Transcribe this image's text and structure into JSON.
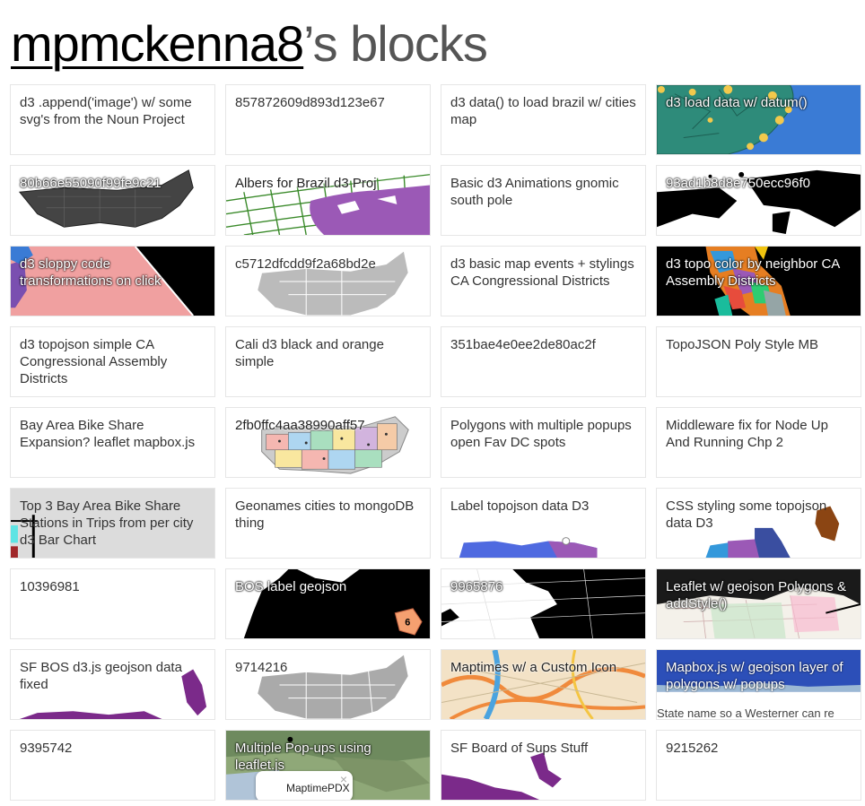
{
  "header": {
    "user": "mpmckenna8",
    "suffix": "’s blocks"
  },
  "cards": [
    {
      "title": "d3 .append('image') w/ some svg's from the Noun Project",
      "thumb": "none"
    },
    {
      "title": "857872609d893d123e67",
      "thumb": "none"
    },
    {
      "title": "d3 data() to load brazil w/ cities map",
      "thumb": "none"
    },
    {
      "title": "d3 load data w/ datum()",
      "thumb": "brazil-cities"
    },
    {
      "title": "80b66e55090f99fe9c21",
      "thumb": "us-dark-counties"
    },
    {
      "title": "Albers for Brazil d3 Proj",
      "thumb": "albers-grid"
    },
    {
      "title": "Basic d3 Animations gnomic south pole",
      "thumb": "none"
    },
    {
      "title": "93ad1b8d8e750ecc96f0",
      "thumb": "black-world"
    },
    {
      "title": "d3 sloppy code transformations on click",
      "thumb": "sloppy-pink"
    },
    {
      "title": "c5712dfcdd9f2a68bd2e",
      "thumb": "us-gray"
    },
    {
      "title": "d3 basic map events + stylings CA Congressional Districts",
      "thumb": "none"
    },
    {
      "title": "d3 topo color by neighbor CA Assembly Districts",
      "thumb": "ca-colored"
    },
    {
      "title": "d3 topojson simple CA Congressional Assembly Districts",
      "thumb": "none"
    },
    {
      "title": "Cali d3 black and orange simple",
      "thumb": "none"
    },
    {
      "title": "351bae4e0ee2de80ac2f",
      "thumb": "none"
    },
    {
      "title": "TopoJSON Poly Style MB",
      "thumb": "none"
    },
    {
      "title": "Bay Area Bike Share Expansion? leaflet mapbox.js",
      "thumb": "none"
    },
    {
      "title": "2fb0ffc4aa38990aff57",
      "thumb": "us-colored-counties"
    },
    {
      "title": "Polygons with multiple popups open Fav DC spots",
      "thumb": "none"
    },
    {
      "title": "Middleware fix for Node Up And Running Chp 2",
      "thumb": "none"
    },
    {
      "title": "Top 3 Bay Area Bike Share Stations in Trips from per city d3 Bar Chart",
      "thumb": "bar-gray"
    },
    {
      "title": "Geonames cities to mongoDB thing",
      "thumb": "none"
    },
    {
      "title": "Label topojson data D3",
      "thumb": "sf-colored"
    },
    {
      "title": "CSS styling some topojson data D3",
      "thumb": "sf-bayview"
    },
    {
      "title": "10396981",
      "thumb": "none"
    },
    {
      "title": "BOS label geojson",
      "thumb": "bos-black"
    },
    {
      "title": "9965876",
      "thumb": "world-black-gray"
    },
    {
      "title": "Leaflet w/ geojson Polygons & addStyle()",
      "thumb": "leaflet-sf"
    },
    {
      "title": "SF BOS d3.js geojson data fixed",
      "thumb": "sf-purple"
    },
    {
      "title": "9714216",
      "thumb": "us-gray2"
    },
    {
      "title": "Maptimes w/ a Custom Icon",
      "thumb": "maptimes"
    },
    {
      "title": "Mapbox.js w/ geojson layer of polygons w/ popups",
      "thumb": "mapbox-blue"
    },
    {
      "title": "9395742",
      "thumb": "none"
    },
    {
      "title": "Multiple Pop-ups using leaflet.js",
      "thumb": "terrain-popup"
    },
    {
      "title": "SF Board of Sups Stuff",
      "thumb": "sf-board"
    },
    {
      "title": "9215262",
      "thumb": "none"
    }
  ],
  "extra_texts": {
    "mapbox_caption": "State name so a Westerner can re",
    "popup_label": "MaptimePDX",
    "popup_close": "×",
    "district_number": "6"
  },
  "colors": {
    "card_border": "#e6e6e6",
    "title_text": "#333333",
    "header_gray": "#555555"
  }
}
